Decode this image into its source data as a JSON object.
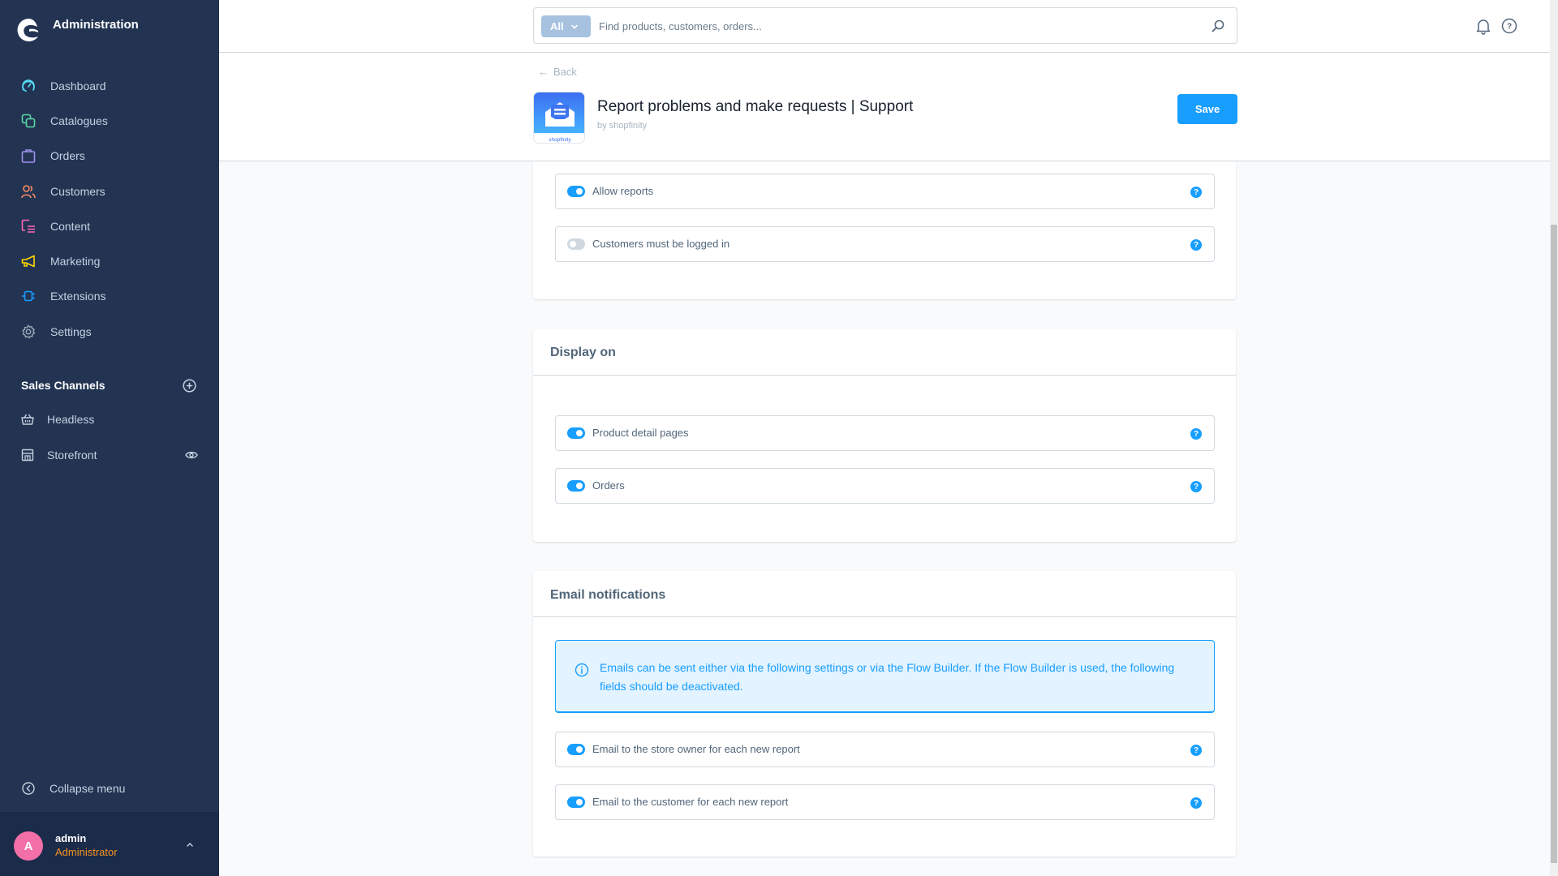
{
  "app": {
    "title": "Administration"
  },
  "sidebar": {
    "items": [
      {
        "label": "Dashboard",
        "icon": "dashboard-icon",
        "color": "#57d9f5"
      },
      {
        "label": "Catalogues",
        "icon": "catalogues-icon",
        "color": "#57d9a3"
      },
      {
        "label": "Orders",
        "icon": "orders-icon",
        "color": "#a092f0"
      },
      {
        "label": "Customers",
        "icon": "customers-icon",
        "color": "#f88962"
      },
      {
        "label": "Content",
        "icon": "content-icon",
        "color": "#ff68b4"
      },
      {
        "label": "Marketing",
        "icon": "marketing-icon",
        "color": "#ffd700"
      },
      {
        "label": "Extensions",
        "icon": "extensions-icon",
        "color": "#189eff"
      },
      {
        "label": "Settings",
        "icon": "settings-icon",
        "color": "#9aa8b5"
      }
    ],
    "sales_channels": {
      "title": "Sales Channels",
      "items": [
        {
          "label": "Headless",
          "icon": "basket-icon"
        },
        {
          "label": "Storefront",
          "icon": "storefront-icon"
        }
      ]
    },
    "collapse_label": "Collapse menu",
    "user": {
      "initial": "A",
      "name": "admin",
      "role": "Administrator"
    }
  },
  "search": {
    "type_label": "All",
    "placeholder": "Find products, customers, orders..."
  },
  "header": {
    "back_label": "Back",
    "app_name": "Report problems and make requests | Support",
    "author": "by shopfinity",
    "icon_brand": "shopfinity",
    "save_label": "Save"
  },
  "cards": {
    "general": {
      "fields": [
        {
          "label": "Allow reports",
          "enabled": true
        },
        {
          "label": "Customers must be logged in",
          "enabled": false
        }
      ]
    },
    "display_on": {
      "title": "Display on",
      "fields": [
        {
          "label": "Product detail pages",
          "enabled": true
        },
        {
          "label": "Orders",
          "enabled": true
        }
      ]
    },
    "email": {
      "title": "Email notifications",
      "info": "Emails can be sent either via the following settings or via the Flow Builder. If the Flow Builder is used, the following fields should be deactivated.",
      "fields": [
        {
          "label": "Email to the store owner for each new report",
          "enabled": true
        },
        {
          "label": "Email to the customer for each new report",
          "enabled": true
        }
      ]
    }
  },
  "colors": {
    "sidebar_bg": "#233453",
    "accent": "#189eff",
    "user_role": "#f7931e",
    "avatar": "#f36fa8"
  }
}
